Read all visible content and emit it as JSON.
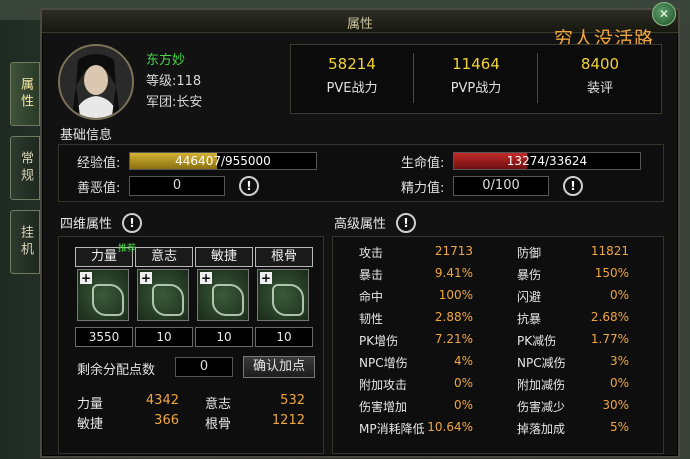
{
  "window": {
    "title": "属性",
    "guild_title": "穷人没活路",
    "close": "✕"
  },
  "side_tabs": [
    "属性",
    "常规",
    "挂机"
  ],
  "player": {
    "name": "东方妙",
    "level": "等级:118",
    "legion": "军团:长安"
  },
  "scores": [
    {
      "value": "58214",
      "label": "PVE战力"
    },
    {
      "value": "11464",
      "label": "PVP战力"
    },
    {
      "value": "8400",
      "label": "装评"
    }
  ],
  "basic": {
    "title": "基础信息",
    "exp_label": "经验值:",
    "exp_text": "446407/955000",
    "exp_fraction": 0.467,
    "hp_label": "生命值:",
    "hp_text": "13274/33624",
    "hp_fraction": 0.395,
    "karma_label": "善恶值:",
    "karma_value": "0",
    "energy_label": "精力值:",
    "energy_value": "0/100",
    "info_glyph": "!"
  },
  "four_attr": {
    "title": "四维属性",
    "recommend": "推荐",
    "heads": [
      "力量",
      "意志",
      "敏捷",
      "根骨"
    ],
    "values": [
      "3550",
      "10",
      "10",
      "10"
    ],
    "plus": "+",
    "remaining_label": "剩余分配点数",
    "remaining_value": "0",
    "confirm_button": "确认加点",
    "summary": [
      {
        "label": "力量",
        "value": "4342"
      },
      {
        "label": "意志",
        "value": "532"
      },
      {
        "label": "敏捷",
        "value": "366"
      },
      {
        "label": "根骨",
        "value": "1212"
      }
    ]
  },
  "advanced": {
    "title": "高级属性",
    "rows": [
      {
        "l1": "攻击",
        "v1": "21713",
        "l2": "防御",
        "v2": "11821"
      },
      {
        "l1": "暴击",
        "v1": "9.41%",
        "l2": "暴伤",
        "v2": "150%"
      },
      {
        "l1": "命中",
        "v1": "100%",
        "l2": "闪避",
        "v2": "0%"
      },
      {
        "l1": "韧性",
        "v1": "2.88%",
        "l2": "抗暴",
        "v2": "2.68%"
      },
      {
        "l1": "PK增伤",
        "v1": "7.21%",
        "l2": "PK减伤",
        "v2": "1.77%"
      },
      {
        "l1": "NPC增伤",
        "v1": "4%",
        "l2": "NPC减伤",
        "v2": "3%"
      },
      {
        "l1": "附加攻击",
        "v1": "0%",
        "l2": "附加减伤",
        "v2": "0%"
      },
      {
        "l1": "伤害增加",
        "v1": "0%",
        "l2": "伤害减少",
        "v2": "30%"
      },
      {
        "l1": "MP消耗降低",
        "v1": "10.64%",
        "l2": "掉落加成",
        "v2": "5%"
      }
    ]
  },
  "colors": {
    "exp_fill": "#d4b233",
    "hp_fill": "#c22a2a",
    "value_orange": "#f0a640",
    "name_green": "#4ad44a",
    "score_yellow": "#f0d23a"
  }
}
